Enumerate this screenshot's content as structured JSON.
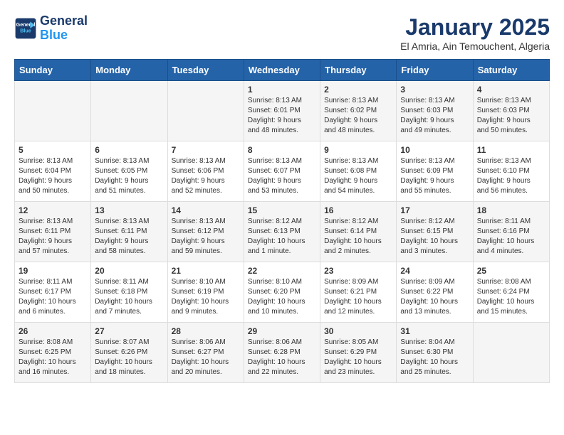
{
  "logo": {
    "line1": "General",
    "line2": "Blue"
  },
  "title": "January 2025",
  "subtitle": "El Amria, Ain Temouchent, Algeria",
  "header_days": [
    "Sunday",
    "Monday",
    "Tuesday",
    "Wednesday",
    "Thursday",
    "Friday",
    "Saturday"
  ],
  "weeks": [
    [
      {
        "day": "",
        "info": ""
      },
      {
        "day": "",
        "info": ""
      },
      {
        "day": "",
        "info": ""
      },
      {
        "day": "1",
        "info": "Sunrise: 8:13 AM\nSunset: 6:01 PM\nDaylight: 9 hours\nand 48 minutes."
      },
      {
        "day": "2",
        "info": "Sunrise: 8:13 AM\nSunset: 6:02 PM\nDaylight: 9 hours\nand 48 minutes."
      },
      {
        "day": "3",
        "info": "Sunrise: 8:13 AM\nSunset: 6:03 PM\nDaylight: 9 hours\nand 49 minutes."
      },
      {
        "day": "4",
        "info": "Sunrise: 8:13 AM\nSunset: 6:03 PM\nDaylight: 9 hours\nand 50 minutes."
      }
    ],
    [
      {
        "day": "5",
        "info": "Sunrise: 8:13 AM\nSunset: 6:04 PM\nDaylight: 9 hours\nand 50 minutes."
      },
      {
        "day": "6",
        "info": "Sunrise: 8:13 AM\nSunset: 6:05 PM\nDaylight: 9 hours\nand 51 minutes."
      },
      {
        "day": "7",
        "info": "Sunrise: 8:13 AM\nSunset: 6:06 PM\nDaylight: 9 hours\nand 52 minutes."
      },
      {
        "day": "8",
        "info": "Sunrise: 8:13 AM\nSunset: 6:07 PM\nDaylight: 9 hours\nand 53 minutes."
      },
      {
        "day": "9",
        "info": "Sunrise: 8:13 AM\nSunset: 6:08 PM\nDaylight: 9 hours\nand 54 minutes."
      },
      {
        "day": "10",
        "info": "Sunrise: 8:13 AM\nSunset: 6:09 PM\nDaylight: 9 hours\nand 55 minutes."
      },
      {
        "day": "11",
        "info": "Sunrise: 8:13 AM\nSunset: 6:10 PM\nDaylight: 9 hours\nand 56 minutes."
      }
    ],
    [
      {
        "day": "12",
        "info": "Sunrise: 8:13 AM\nSunset: 6:11 PM\nDaylight: 9 hours\nand 57 minutes."
      },
      {
        "day": "13",
        "info": "Sunrise: 8:13 AM\nSunset: 6:11 PM\nDaylight: 9 hours\nand 58 minutes."
      },
      {
        "day": "14",
        "info": "Sunrise: 8:13 AM\nSunset: 6:12 PM\nDaylight: 9 hours\nand 59 minutes."
      },
      {
        "day": "15",
        "info": "Sunrise: 8:12 AM\nSunset: 6:13 PM\nDaylight: 10 hours\nand 1 minute."
      },
      {
        "day": "16",
        "info": "Sunrise: 8:12 AM\nSunset: 6:14 PM\nDaylight: 10 hours\nand 2 minutes."
      },
      {
        "day": "17",
        "info": "Sunrise: 8:12 AM\nSunset: 6:15 PM\nDaylight: 10 hours\nand 3 minutes."
      },
      {
        "day": "18",
        "info": "Sunrise: 8:11 AM\nSunset: 6:16 PM\nDaylight: 10 hours\nand 4 minutes."
      }
    ],
    [
      {
        "day": "19",
        "info": "Sunrise: 8:11 AM\nSunset: 6:17 PM\nDaylight: 10 hours\nand 6 minutes."
      },
      {
        "day": "20",
        "info": "Sunrise: 8:11 AM\nSunset: 6:18 PM\nDaylight: 10 hours\nand 7 minutes."
      },
      {
        "day": "21",
        "info": "Sunrise: 8:10 AM\nSunset: 6:19 PM\nDaylight: 10 hours\nand 9 minutes."
      },
      {
        "day": "22",
        "info": "Sunrise: 8:10 AM\nSunset: 6:20 PM\nDaylight: 10 hours\nand 10 minutes."
      },
      {
        "day": "23",
        "info": "Sunrise: 8:09 AM\nSunset: 6:21 PM\nDaylight: 10 hours\nand 12 minutes."
      },
      {
        "day": "24",
        "info": "Sunrise: 8:09 AM\nSunset: 6:22 PM\nDaylight: 10 hours\nand 13 minutes."
      },
      {
        "day": "25",
        "info": "Sunrise: 8:08 AM\nSunset: 6:24 PM\nDaylight: 10 hours\nand 15 minutes."
      }
    ],
    [
      {
        "day": "26",
        "info": "Sunrise: 8:08 AM\nSunset: 6:25 PM\nDaylight: 10 hours\nand 16 minutes."
      },
      {
        "day": "27",
        "info": "Sunrise: 8:07 AM\nSunset: 6:26 PM\nDaylight: 10 hours\nand 18 minutes."
      },
      {
        "day": "28",
        "info": "Sunrise: 8:06 AM\nSunset: 6:27 PM\nDaylight: 10 hours\nand 20 minutes."
      },
      {
        "day": "29",
        "info": "Sunrise: 8:06 AM\nSunset: 6:28 PM\nDaylight: 10 hours\nand 22 minutes."
      },
      {
        "day": "30",
        "info": "Sunrise: 8:05 AM\nSunset: 6:29 PM\nDaylight: 10 hours\nand 23 minutes."
      },
      {
        "day": "31",
        "info": "Sunrise: 8:04 AM\nSunset: 6:30 PM\nDaylight: 10 hours\nand 25 minutes."
      },
      {
        "day": "",
        "info": ""
      }
    ]
  ]
}
